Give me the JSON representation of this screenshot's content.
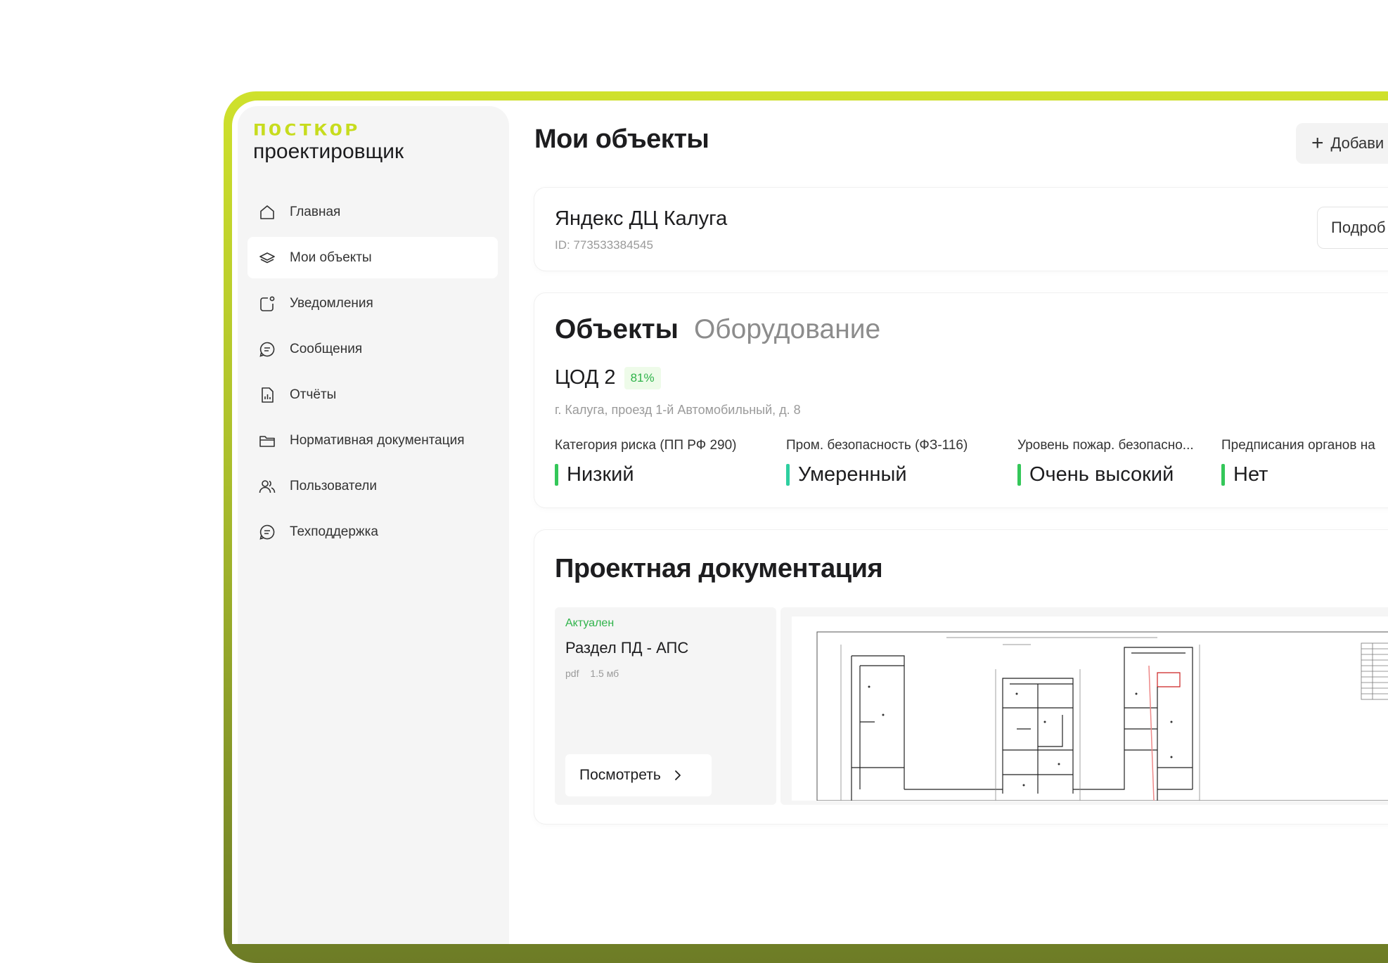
{
  "brand": {
    "logo_top": "ПОСТКОР",
    "logo_bottom": "проектировщик",
    "accent": "#c7dc1e"
  },
  "sidebar": {
    "items": [
      {
        "label": "Главная",
        "icon": "home-icon",
        "active": false
      },
      {
        "label": "Мои объекты",
        "icon": "layers-icon",
        "active": true
      },
      {
        "label": "Уведомления",
        "icon": "notification-icon",
        "active": false
      },
      {
        "label": "Сообщения",
        "icon": "chat-icon",
        "active": false
      },
      {
        "label": "Отчёты",
        "icon": "report-icon",
        "active": false
      },
      {
        "label": "Нормативная документация",
        "icon": "folder-icon",
        "active": false
      },
      {
        "label": "Пользователи",
        "icon": "users-icon",
        "active": false
      },
      {
        "label": "Техподдержка",
        "icon": "support-icon",
        "active": false
      }
    ]
  },
  "main": {
    "title": "Мои объекты",
    "add_button": "Добави",
    "project": {
      "name": "Яндекс ДЦ Калуга",
      "id": "ID: 773533384545",
      "detail_button": "Подроб"
    },
    "tabs": [
      {
        "label": "Объекты",
        "active": true
      },
      {
        "label": "Оборудование",
        "active": false
      }
    ],
    "object": {
      "name": "ЦОД 2",
      "progress": "81%",
      "address": "г. Калуга, проезд 1-й Автомобильный, д. 8",
      "metrics": [
        {
          "label": "Категория риска (ПП РФ 290)",
          "value": "Низкий",
          "color": "#34c759"
        },
        {
          "label": "Пром. безопасность (ФЗ-116)",
          "value": "Умеренный",
          "color": "#2ecfa0"
        },
        {
          "label": "Уровень пожар. безопасно...",
          "value": "Очень высокий",
          "color": "#34c759"
        },
        {
          "label": "Предписания органов на",
          "value": "Нет",
          "color": "#34c759"
        }
      ]
    },
    "docs": {
      "title": "Проектная документация",
      "items": [
        {
          "status": "Актуален",
          "name": "Раздел ПД - АПС",
          "format": "pdf",
          "size": "1.5 мб",
          "view_button": "Посмотреть"
        }
      ]
    }
  }
}
